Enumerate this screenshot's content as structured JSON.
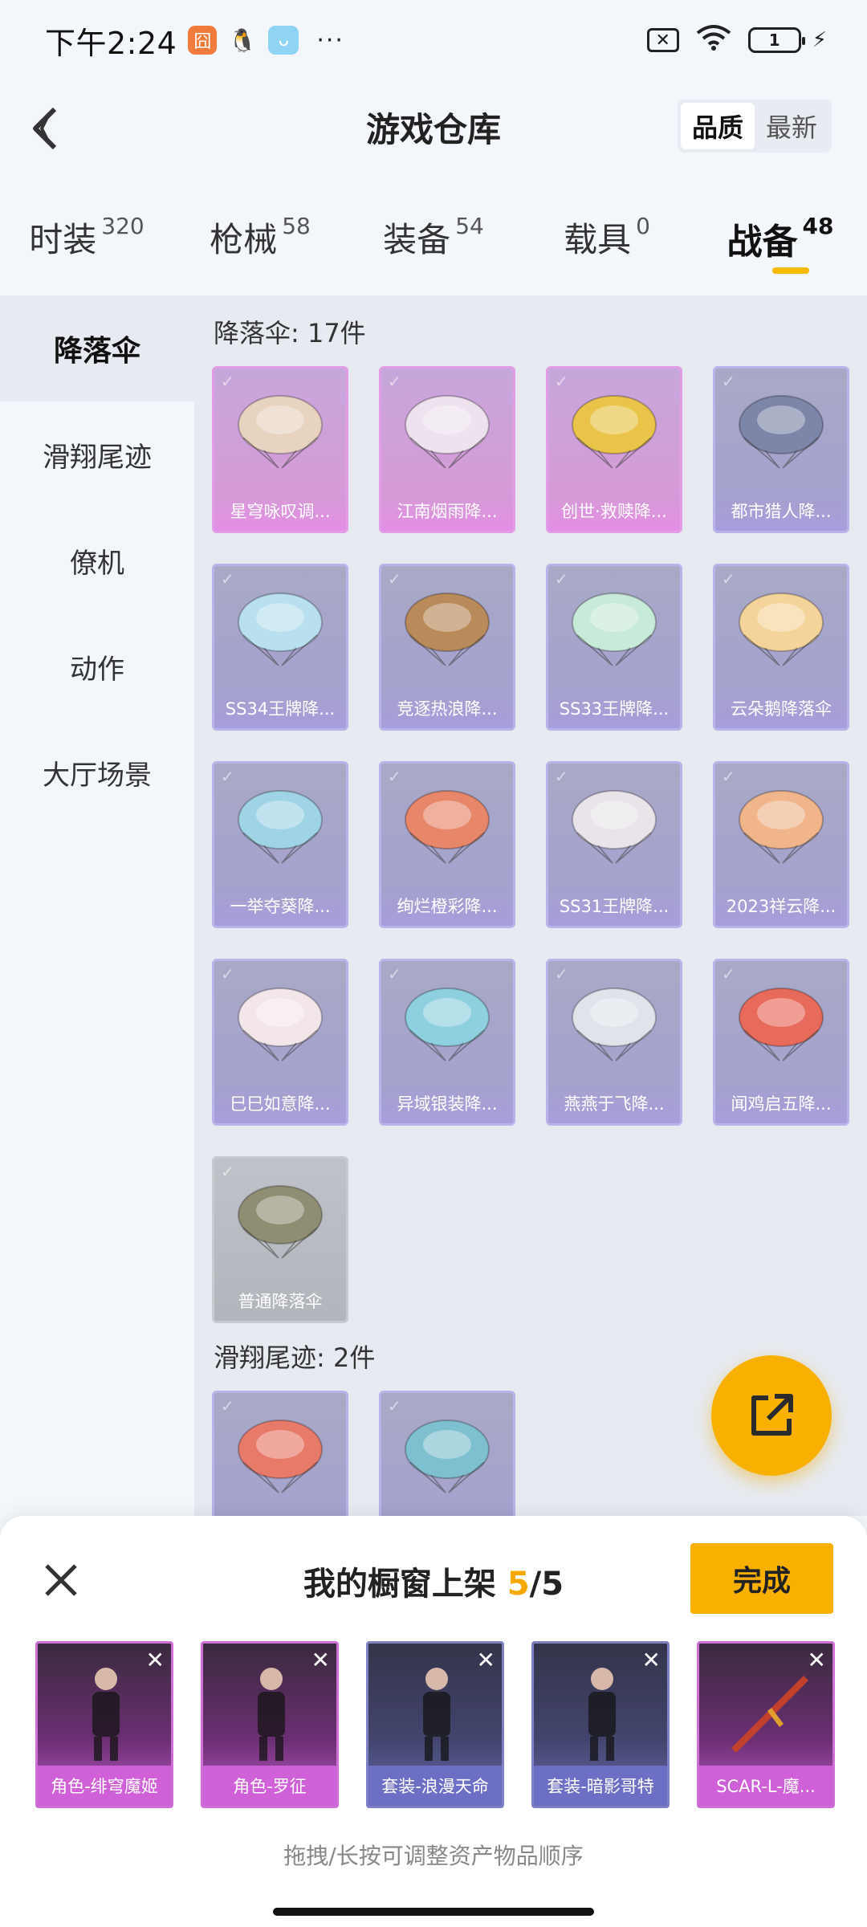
{
  "status_bar": {
    "time": "下午2:24",
    "battery": "1"
  },
  "header": {
    "title": "游戏仓库",
    "sort_options": [
      "品质",
      "最新"
    ],
    "sort_active": 0
  },
  "tabs": [
    {
      "label": "时装",
      "count": "320"
    },
    {
      "label": "枪械",
      "count": "58"
    },
    {
      "label": "装备",
      "count": "54"
    },
    {
      "label": "载具",
      "count": "0"
    },
    {
      "label": "战备",
      "count": "48"
    }
  ],
  "active_tab": 4,
  "sidebar": [
    "降落伞",
    "滑翔尾迹",
    "僚机",
    "动作",
    "大厅场景"
  ],
  "sections": [
    {
      "title": "降落伞: 17件",
      "items": [
        {
          "label": "星穹咏叹调...",
          "rarity": "pink",
          "color": "#e8d2c0"
        },
        {
          "label": "江南烟雨降...",
          "rarity": "pink",
          "color": "#efe2ef"
        },
        {
          "label": "创世·救赎降...",
          "rarity": "pink",
          "color": "#e9c448"
        },
        {
          "label": "都市猎人降...",
          "rarity": "purple",
          "color": "#7d86a8"
        },
        {
          "label": "SS34王牌降...",
          "rarity": "purple",
          "color": "#b9e0ef"
        },
        {
          "label": "竞逐热浪降...",
          "rarity": "purple",
          "color": "#b98a5a"
        },
        {
          "label": "SS33王牌降...",
          "rarity": "purple",
          "color": "#c8ead8"
        },
        {
          "label": "云朵鹅降落伞",
          "rarity": "purple",
          "color": "#f4d49a"
        },
        {
          "label": "一举夺葵降...",
          "rarity": "purple",
          "color": "#9fd4e6"
        },
        {
          "label": "绚烂橙彩降...",
          "rarity": "purple",
          "color": "#e8866a"
        },
        {
          "label": "SS31王牌降...",
          "rarity": "purple",
          "color": "#e9e3ea"
        },
        {
          "label": "2023祥云降...",
          "rarity": "purple",
          "color": "#f0b58a"
        },
        {
          "label": "巳巳如意降...",
          "rarity": "purple",
          "color": "#f3e6ea"
        },
        {
          "label": "异域银装降...",
          "rarity": "purple",
          "color": "#8ed0df"
        },
        {
          "label": "燕燕于飞降...",
          "rarity": "purple",
          "color": "#dfe3ea"
        },
        {
          "label": "闻鸡启五降...",
          "rarity": "purple",
          "color": "#e86a5a"
        },
        {
          "label": "普通降落伞",
          "rarity": "gray",
          "color": "#8f8d72"
        }
      ]
    },
    {
      "title": "滑翔尾迹: 2件",
      "items": [
        {
          "label": "",
          "rarity": "purple",
          "color": "#e87a6a"
        },
        {
          "label": "",
          "rarity": "purple",
          "color": "#7fc0d0"
        }
      ]
    }
  ],
  "sheet": {
    "title_prefix": "我的橱窗上架 ",
    "count": "5",
    "total": "/5",
    "done_label": "完成",
    "hint": "拖拽/长按可调整资产物品顺序",
    "items": [
      {
        "label": "角色-绯穹魔姬",
        "rarity": "pink"
      },
      {
        "label": "角色-罗征",
        "rarity": "pink"
      },
      {
        "label": "套装-浪漫天命",
        "rarity": "purple"
      },
      {
        "label": "套装-暗影哥特",
        "rarity": "purple"
      },
      {
        "label": "SCAR-L-魔...",
        "rarity": "pink"
      }
    ]
  }
}
